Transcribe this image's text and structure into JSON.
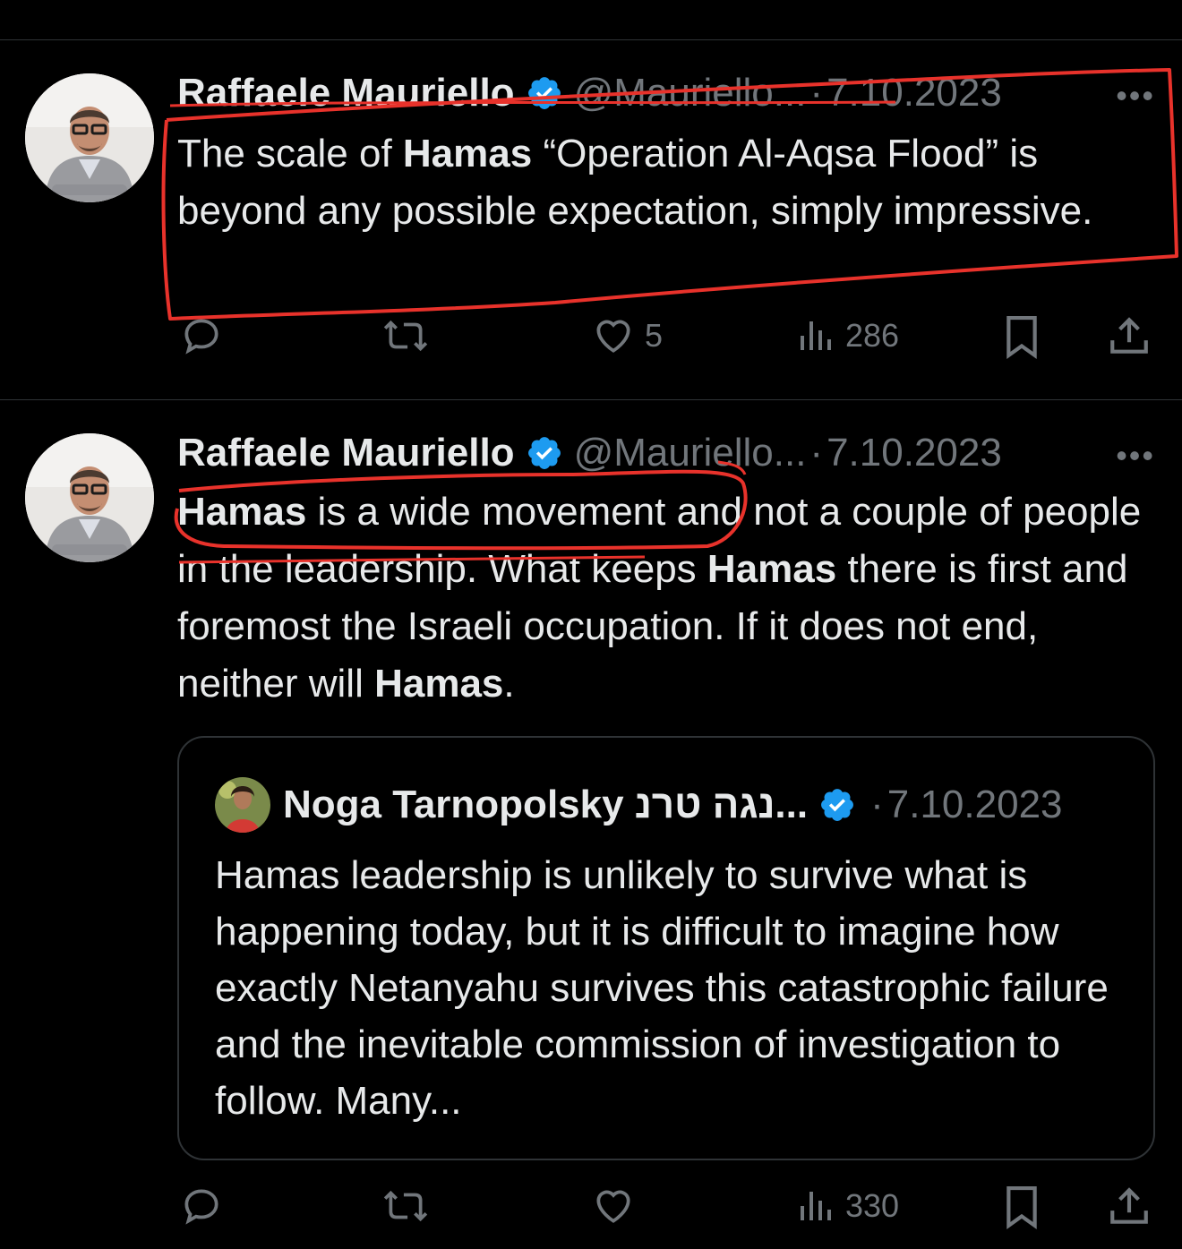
{
  "tweets": [
    {
      "author_name": "Raffaele Mauriello",
      "handle": "@Mauriello...",
      "separator": "·",
      "date": "7.10.2023",
      "more": "•••",
      "text_parts": [
        {
          "text": "The scale of ",
          "bold": false
        },
        {
          "text": "Hamas",
          "bold": true
        },
        {
          "text": " “Operation Al-Aqsa Flood” is beyond any possible expectation, simply impressive.",
          "bold": false
        }
      ],
      "stats": {
        "reply": "",
        "retweet": "",
        "like": "5",
        "views": "286"
      }
    },
    {
      "author_name": "Raffaele Mauriello",
      "handle": "@Mauriello...",
      "separator": "·",
      "date": "7.10.2023",
      "more": "•••",
      "text_parts": [
        {
          "text": "Hamas",
          "bold": true
        },
        {
          "text": " is a wide movement and not a couple of people in the leadership. What keeps ",
          "bold": false
        },
        {
          "text": "Hamas",
          "bold": true
        },
        {
          "text": " there is first and foremost the Israeli occupation. If it does not end, neither will ",
          "bold": false
        },
        {
          "text": "Hamas",
          "bold": true
        },
        {
          "text": ".",
          "bold": false
        }
      ],
      "quote": {
        "author_name": "Noga Tarnopolsky נגה טרנ...",
        "separator": "·",
        "date": "7.10.2023",
        "text": "Hamas leadership is unlikely to survive what is happening today, but it is difficult to imagine how exactly Netanyahu survives this catastrophic failure and the inevitable commission of investigation to follow. Many..."
      },
      "stats": {
        "reply": "",
        "retweet": "",
        "like": "",
        "views": "330"
      }
    }
  ],
  "colors": {
    "background": "#000000",
    "text": "#e7e9ea",
    "secondary": "#71767b",
    "verified": "#1d9bf0",
    "annotation": "#e8322b"
  }
}
